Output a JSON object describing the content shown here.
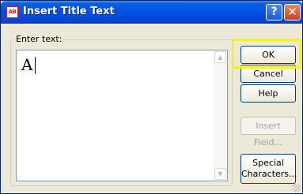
{
  "window": {
    "title": "Insert Title Text",
    "icon_text": "AB",
    "help_glyph": "?",
    "close_glyph": "✕"
  },
  "text_group": {
    "label": "Enter text:",
    "value": "A"
  },
  "buttons": {
    "ok": "OK",
    "cancel": "Cancel",
    "help": "Help",
    "insert_field": "Insert Field...",
    "special_line1": "Special",
    "special_line2": "Characters..."
  },
  "scrollbar": {
    "up_glyph": "▲",
    "down_glyph": "▼"
  },
  "colors": {
    "titlebar": "#0055e5",
    "highlight": "#f5f21e",
    "disabled_text": "#a0a0a0"
  }
}
